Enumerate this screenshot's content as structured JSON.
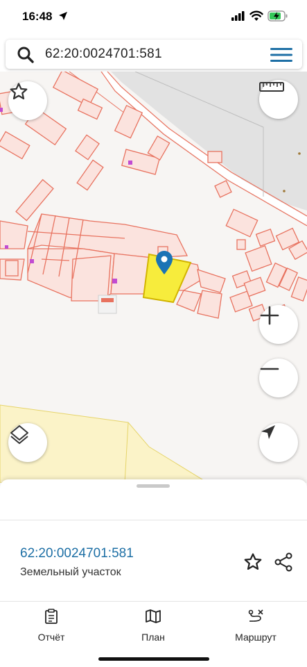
{
  "status": {
    "time": "16:48"
  },
  "search": {
    "query": "62:20:0024701:581"
  },
  "sheet": {
    "parcel_id": "62:20:0024701:581",
    "parcel_type": "Земельный участок"
  },
  "tabs": [
    {
      "label": "Отчёт",
      "icon": "report-icon"
    },
    {
      "label": "План",
      "icon": "map-plan-icon"
    },
    {
      "label": "Маршрут",
      "icon": "route-icon"
    }
  ],
  "colors": {
    "parcel_fill": "#fbe3de",
    "parcel_stroke": "#e8725f",
    "selected_fill": "#f7ec3c",
    "road_fill": "#e6e6e6",
    "zone_fill": "#fbf3c8",
    "link": "#1d6fa5",
    "pin": "#1a73b5"
  },
  "map_buttons": [
    "favorite-star-icon",
    "ruler-icon",
    "zoom-in-icon",
    "zoom-out-icon",
    "layers-icon",
    "locate-me-icon"
  ]
}
